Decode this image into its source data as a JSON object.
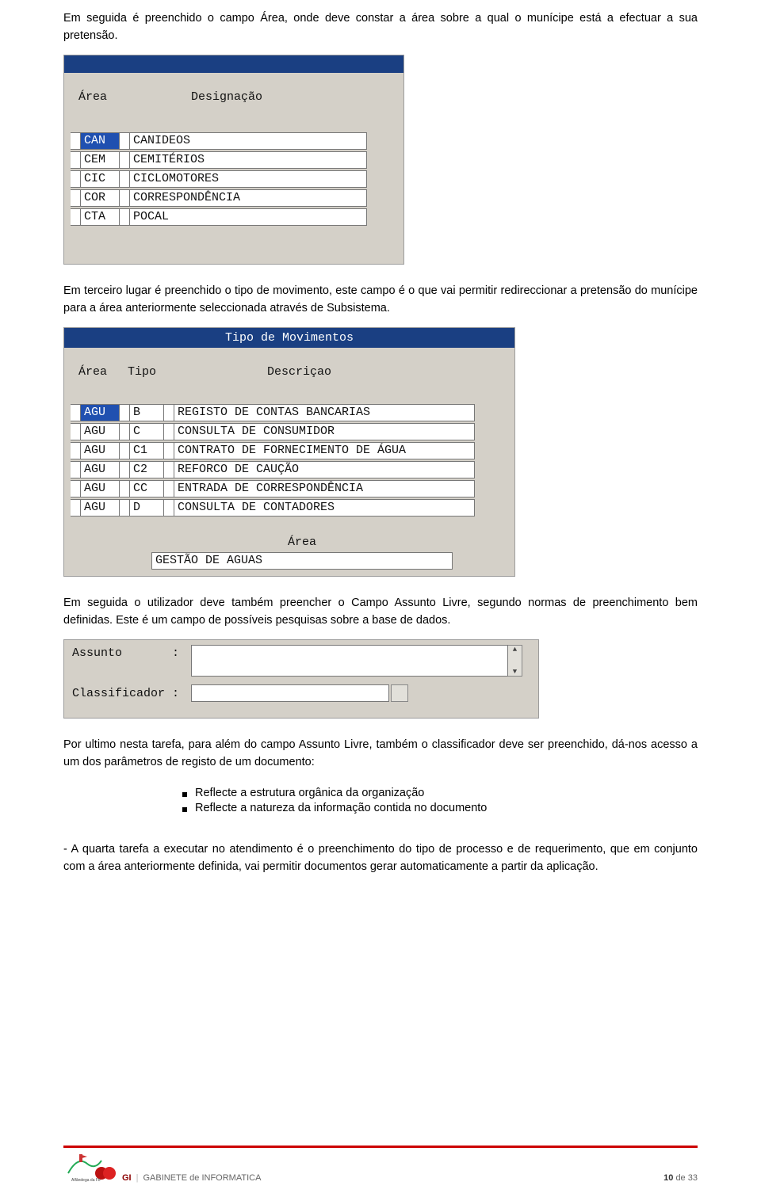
{
  "para1": "Em seguida é preenchido o campo Área, onde deve constar a área sobre a qual o munícipe está a efectuar a sua pretensão.",
  "panel1": {
    "headers": {
      "area": "Área",
      "desig": "Designação"
    },
    "rows": [
      {
        "code": "CAN",
        "label": "CANIDEOS",
        "selected": true
      },
      {
        "code": "CEM",
        "label": "CEMITÉRIOS",
        "selected": false
      },
      {
        "code": "CIC",
        "label": "CICLOMOTORES",
        "selected": false
      },
      {
        "code": "COR",
        "label": "CORRESPONDÊNCIA",
        "selected": false
      },
      {
        "code": "CTA",
        "label": "POCAL",
        "selected": false
      }
    ]
  },
  "para2": "Em terceiro lugar é preenchido o tipo de movimento, este campo é o que vai permitir redireccionar a pretensão do munícipe para a área anteriormente seleccionada através de Subsistema.",
  "panel2": {
    "title": "Tipo de Movimentos",
    "headers": {
      "area": "Área",
      "tipo": "Tipo",
      "desc": "Descriçao"
    },
    "rows": [
      {
        "area": "AGU",
        "tipo": "B",
        "desc": "REGISTO DE CONTAS BANCARIAS",
        "selected": true
      },
      {
        "area": "AGU",
        "tipo": "C",
        "desc": "CONSULTA DE CONSUMIDOR",
        "selected": false
      },
      {
        "area": "AGU",
        "tipo": "C1",
        "desc": "CONTRATO DE FORNECIMENTO DE ÁGUA",
        "selected": false
      },
      {
        "area": "AGU",
        "tipo": "C2",
        "desc": "REFORCO DE CAUÇÃO",
        "selected": false
      },
      {
        "area": "AGU",
        "tipo": "CC",
        "desc": "ENTRADA DE CORRESPONDÊNCIA",
        "selected": false
      },
      {
        "area": "AGU",
        "tipo": "D",
        "desc": "CONSULTA DE CONTADORES",
        "selected": false
      }
    ],
    "sub_label": "Área",
    "sub_value": "GESTÃO DE AGUAS"
  },
  "para3": "Em seguida o utilizador deve também preencher o Campo Assunto Livre, segundo normas de preenchimento bem definidas. Este é um campo de possíveis pesquisas sobre a base de dados.",
  "panel3": {
    "assunto_label": "Assunto",
    "colon": ":",
    "classificador_label": "Classificador",
    "assunto_value": "",
    "classificador_value": ""
  },
  "para4": "Por ultimo nesta tarefa, para além do campo Assunto Livre, também o classificador deve ser preenchido, dá-nos acesso a um dos parâmetros de registo de um documento:",
  "bullets": [
    "Reflecte a estrutura orgânica da organização",
    "Reflecte a natureza da informação contida no documento"
  ],
  "para5": "- A quarta tarefa a executar no atendimento é o preenchimento do tipo de processo e de requerimento, que em conjunto com a área anteriormente definida, vai permitir documentos gerar automaticamente a partir da aplicação.",
  "footer": {
    "gi": "GI",
    "dept": "GABINETE de INFORMATICA",
    "page_current": "10",
    "page_sep": "de",
    "page_total": "33"
  }
}
